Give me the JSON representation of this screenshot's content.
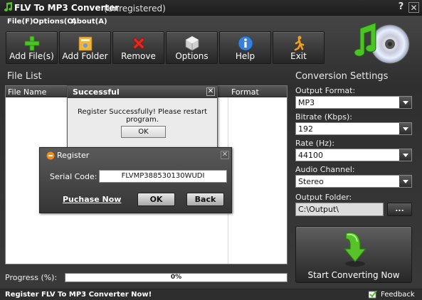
{
  "window": {
    "title": "FLV To MP3 Converter",
    "subtitle": "(Unregistered)",
    "help_glyph": "?",
    "close_glyph": "✕"
  },
  "menu": {
    "items": [
      "File(F)",
      "Options(O)",
      "About(A)"
    ]
  },
  "toolbar": {
    "buttons": [
      {
        "label": "Add File(s)",
        "icon": "add-icon"
      },
      {
        "label": "Add Folder",
        "icon": "folder-icon"
      },
      {
        "label": "Remove",
        "icon": "remove-icon"
      },
      {
        "label": "Options",
        "icon": "options-icon"
      },
      {
        "label": "Help",
        "icon": "help-icon"
      },
      {
        "label": "Exit",
        "icon": "exit-icon"
      }
    ]
  },
  "file_list": {
    "title": "File List",
    "columns": [
      "File Name",
      "Format"
    ]
  },
  "progress": {
    "label": "Progress (%):",
    "value_text": "0%",
    "value": 0
  },
  "status": {
    "register_text": "Register FLV To MP3 Converter Now!",
    "feedback": "Feedback"
  },
  "settings": {
    "title": "Conversion Settings",
    "output_format": {
      "label": "Output Format:",
      "value": "MP3"
    },
    "bitrate": {
      "label": "Bitrate (Kbps):",
      "value": "192"
    },
    "rate": {
      "label": "Rate (Hz):",
      "value": "44100"
    },
    "audio_channel": {
      "label": "Audio Channel:",
      "value": "Stereo"
    },
    "output_folder": {
      "label": "Output Folder:",
      "value": "C:\\Output\\",
      "browse": "..."
    },
    "start_button": "Start Converting Now"
  },
  "success_dialog": {
    "title": "Successful",
    "message": "Register Successfully! Please restart program.",
    "ok": "OK"
  },
  "register_dialog": {
    "title": "Register",
    "serial_label": "Serial Code:",
    "serial_value": "FLVMP388530130WUDI",
    "purchase_link": "Puchase Now",
    "ok": "OK",
    "back": "Back"
  },
  "colors": {
    "accent_green": "#58c22a",
    "progress_fill": "#4aa8e0"
  }
}
